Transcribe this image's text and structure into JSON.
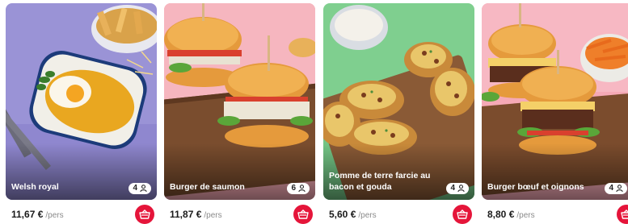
{
  "currency_unit": "/pers",
  "cards": [
    {
      "title": "Welsh royal",
      "persons": "4",
      "price": "11,67 €",
      "unit": "/pers"
    },
    {
      "title": "Burger de saumon",
      "persons": "6",
      "price": "11,87 €",
      "unit": "/pers"
    },
    {
      "title": "Pomme de terre farcie au bacon et gouda",
      "persons": "4",
      "price": "5,60 €",
      "unit": "/pers"
    },
    {
      "title": "Burger bœuf et oignons",
      "persons": "4",
      "price": "8,80 €",
      "unit": "/pers"
    }
  ],
  "icons": {
    "persons": "person-icon",
    "cart": "basket-icon"
  },
  "colors": {
    "cart_button": "#e5153a"
  }
}
